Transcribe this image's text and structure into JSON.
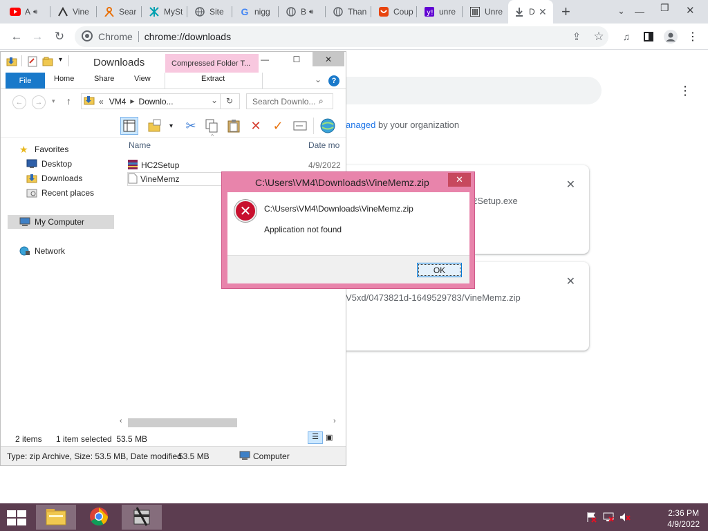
{
  "chrome": {
    "tabs": [
      {
        "title": "A",
        "icon": "youtube-icon",
        "color": "#ff0000",
        "audio": true
      },
      {
        "title": "Vine",
        "icon": "vine-icon",
        "color": "#333333"
      },
      {
        "title": "Sear",
        "icon": "search-person-icon",
        "color": "#e8710a"
      },
      {
        "title": "MySt",
        "icon": "mystery-icon",
        "color": "#00a0b0"
      },
      {
        "title": "Site",
        "icon": "globe-icon",
        "color": "#5f6368"
      },
      {
        "title": "nigg",
        "icon": "google-icon",
        "color": "#4285f4"
      },
      {
        "title": "B",
        "icon": "globe-icon",
        "color": "#5f6368",
        "audio": true
      },
      {
        "title": "Than",
        "icon": "globe-icon",
        "color": "#5f6368"
      },
      {
        "title": "Coup",
        "icon": "coupon-icon",
        "color": "#e8440e"
      },
      {
        "title": "unre",
        "icon": "yahoo-icon",
        "color": "#6001d2"
      },
      {
        "title": "Unre",
        "icon": "museum-icon",
        "color": "#222222"
      },
      {
        "title": "D",
        "icon": "download-icon",
        "color": "#5f6368",
        "active": true
      }
    ],
    "omnibox": {
      "site": "Chrome",
      "url": "chrome://downloads"
    }
  },
  "downloads_page": {
    "managed_link": "anaged",
    "managed_rest": " by your organization",
    "items": [
      {
        "text": "2Setup.exe"
      },
      {
        "text": "V5xd/0473821d-1649529783/VineMemz.zip"
      }
    ]
  },
  "explorer": {
    "title": "Downloads",
    "context_tab": "Compressed Folder T...",
    "ribbon": {
      "file": "File",
      "home": "Home",
      "share": "Share",
      "view": "View",
      "extract": "Extract"
    },
    "address": {
      "chevrons": "«",
      "seg1": "VM4",
      "seg2": "Downlo..."
    },
    "search_placeholder": "Search Downlo...",
    "columns": {
      "name": "Name",
      "date": "Date mo"
    },
    "nav": {
      "favorites": "Favorites",
      "desktop": "Desktop",
      "downloads": "Downloads",
      "recent": "Recent places",
      "computer": "My Computer",
      "network": "Network"
    },
    "files": [
      {
        "name": "HC2Setup",
        "date": "4/9/2022",
        "icon": "winrar-icon"
      },
      {
        "name": "VineMemz",
        "date": "",
        "icon": "file-icon"
      }
    ],
    "status": {
      "count": "2 items",
      "selected": "1 item selected  53.5 MB"
    },
    "details": {
      "info": "Type: zip Archive, Size: 53.5 MB, Date modified",
      "size": "53.5 MB",
      "location": "Computer"
    }
  },
  "dialog": {
    "title": "C:\\Users\\VM4\\Downloads\\VineMemz.zip",
    "path": "C:\\Users\\VM4\\Downloads\\VineMemz.zip",
    "message": "Application not found",
    "ok": "OK"
  },
  "taskbar": {
    "time": "2:36 PM",
    "date": "4/9/2022"
  }
}
